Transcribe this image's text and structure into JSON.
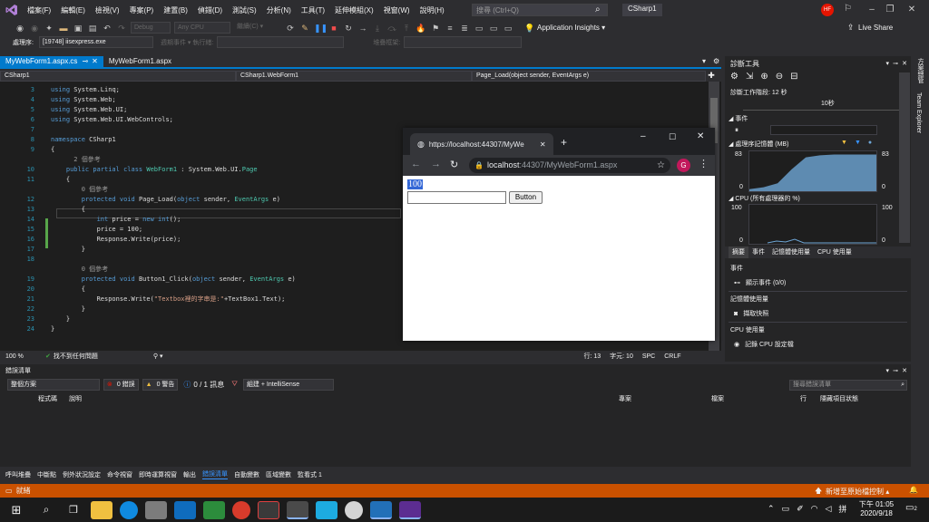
{
  "menu": [
    "檔案(F)",
    "編輯(E)",
    "檢視(V)",
    "專案(P)",
    "建置(B)",
    "偵錯(D)",
    "測試(S)",
    "分析(N)",
    "工具(T)",
    "延伸模組(X)",
    "視窗(W)",
    "說明(H)"
  ],
  "search_placeholder": "搜尋 (Ctrl+Q)",
  "solution_name": "CSharp1",
  "avatar_initials": "HF",
  "toolbar": {
    "config": "Debug",
    "platform": "Any CPU",
    "continue_label": "繼續(C) ▾",
    "app_insights": "Application Insights ▾",
    "live_share": "Live Share"
  },
  "procbar": {
    "process_label": "處理序:",
    "process_value": "[19748] iisexpress.exe",
    "lifecycle": "週期事件 ▾ 執行緒:",
    "stackframe": "堆疊框架:"
  },
  "doc_tabs": [
    "MyWebForm1.aspx.cs",
    "MyWebForm1.aspx"
  ],
  "navbar": {
    "project": "CSharp1",
    "class": "CSharp1.WebForm1",
    "member": "Page_Load(object sender, EventArgs e)"
  },
  "code_lines": [
    {
      "n": "3",
      "code": [
        [
          "kw",
          "using "
        ],
        [
          "tx",
          "System.Linq;"
        ]
      ]
    },
    {
      "n": "4",
      "code": [
        [
          "kw",
          "using "
        ],
        [
          "tx",
          "System.Web;"
        ]
      ]
    },
    {
      "n": "5",
      "code": [
        [
          "kw",
          "using "
        ],
        [
          "tx",
          "System.Web.UI;"
        ]
      ]
    },
    {
      "n": "6",
      "code": [
        [
          "kw",
          "using "
        ],
        [
          "tx",
          "System.Web.UI.WebControls;"
        ]
      ]
    },
    {
      "n": "7",
      "code": []
    },
    {
      "n": "8",
      "code": [
        [
          "kw",
          "namespace "
        ],
        [
          "tx",
          "CSharp1"
        ]
      ]
    },
    {
      "n": "9",
      "code": [
        [
          "tx",
          "{"
        ]
      ]
    },
    {
      "n": "",
      "code": [
        [
          "cm",
          "      2 個參考"
        ]
      ]
    },
    {
      "n": "10",
      "code": [
        [
          "kw",
          "    public partial class "
        ],
        [
          "ty",
          "WebForm1"
        ],
        [
          "tx",
          " : System.Web.UI."
        ],
        [
          "ty",
          "Page"
        ]
      ]
    },
    {
      "n": "11",
      "code": [
        [
          "tx",
          "    {"
        ]
      ]
    },
    {
      "n": "",
      "code": [
        [
          "cm",
          "        0 個參考"
        ]
      ]
    },
    {
      "n": "12",
      "code": [
        [
          "kw",
          "        protected void "
        ],
        [
          "tx",
          "Page_Load("
        ],
        [
          "kw",
          "object "
        ],
        [
          "tx",
          "sender, "
        ],
        [
          "ty",
          "EventArgs"
        ],
        [
          "tx",
          " e)"
        ]
      ]
    },
    {
      "n": "13",
      "code": [
        [
          "tx",
          "        {"
        ]
      ]
    },
    {
      "n": "14",
      "code": [
        [
          "kw",
          "            int"
        ],
        [
          "tx",
          " price = "
        ],
        [
          "kw",
          "new int"
        ],
        [
          "tx",
          "();"
        ]
      ]
    },
    {
      "n": "15",
      "code": [
        [
          "tx",
          "            price = 100;"
        ]
      ]
    },
    {
      "n": "16",
      "code": [
        [
          "tx",
          "            Response.Write(price);"
        ]
      ]
    },
    {
      "n": "17",
      "code": [
        [
          "tx",
          "        }"
        ]
      ]
    },
    {
      "n": "18",
      "code": []
    },
    {
      "n": "",
      "code": [
        [
          "cm",
          "        0 個參考"
        ]
      ]
    },
    {
      "n": "19",
      "code": [
        [
          "kw",
          "        protected void "
        ],
        [
          "tx",
          "Button1_Click("
        ],
        [
          "kw",
          "object "
        ],
        [
          "tx",
          "sender, "
        ],
        [
          "ty",
          "EventArgs"
        ],
        [
          "tx",
          " e)"
        ]
      ]
    },
    {
      "n": "20",
      "code": [
        [
          "tx",
          "        {"
        ]
      ]
    },
    {
      "n": "21",
      "code": [
        [
          "tx",
          "            Response.Write("
        ],
        [
          "st",
          "\"Textbox裡的字串是:\""
        ],
        [
          "tx",
          "+TextBox1.Text);"
        ]
      ]
    },
    {
      "n": "22",
      "code": [
        [
          "tx",
          "        }"
        ]
      ]
    },
    {
      "n": "23",
      "code": [
        [
          "tx",
          "    }"
        ]
      ]
    },
    {
      "n": "24",
      "code": [
        [
          "tx",
          "}"
        ]
      ]
    }
  ],
  "editor_status": {
    "zoom": "100 %",
    "issues": "找不到任何問題",
    "line": "行: 13",
    "col": "字元: 10",
    "spc": "SPC",
    "crlf": "CRLF"
  },
  "browser": {
    "tab_title": "https://localhost:44307/MyWe",
    "url_host": "localhost",
    "url_rest": ":44307/MyWebForm1.aspx",
    "profile": "G",
    "output_text": "100",
    "button_label": "Button"
  },
  "diag": {
    "title": "診斷工具",
    "session": "診斷工作階段: 12 秒",
    "timeline_tick": "10秒",
    "events": "事件",
    "memory": "處理序記憶體 (MB)",
    "mem_max": "83",
    "mem_min": "0",
    "cpu": "CPU (所有處理器的 %)",
    "cpu_max": "100",
    "cpu_min": "0",
    "tabs": [
      "摘要",
      "事件",
      "記憶體使用量",
      "CPU 使用量"
    ],
    "sec_events": "事件",
    "show_events": "顯示事件 (0/0)",
    "sec_memory": "記憶體使用量",
    "snapshot": "擷取快照",
    "sec_cpu": "CPU 使用量",
    "record_cpu": "記錄 CPU 設定檔"
  },
  "memory_fill": [
    0.05,
    0.1,
    0.2,
    0.55,
    0.85,
    0.9,
    0.92,
    0.92,
    0.92,
    0.92
  ],
  "right_tabs": [
    "方案總管",
    "Team Explorer"
  ],
  "errlist": {
    "title": "錯誤清單",
    "scope": "整個方案",
    "errors": "0 錯誤",
    "warnings": "0 警告",
    "messages": "0 / 1 訊息",
    "build_filter": "組建 + IntelliSense",
    "search": "搜尋錯誤清單",
    "col_code": "程式碼",
    "col_desc": "說明",
    "col_project": "專案",
    "col_file": "檔案",
    "col_line": "行",
    "col_suppress": "隱藏項目狀態"
  },
  "bottom_tabs": [
    "呼叫堆疊",
    "中斷點",
    "例外狀況設定",
    "命令視窗",
    "即時運算視窗",
    "輸出",
    "錯誤清單",
    "自動變數",
    "區域變數",
    "監看式 1"
  ],
  "statusbar": {
    "ready": "就緒",
    "source_control": "新增至原始檔控制 ▴"
  },
  "taskbar": {
    "time": "下午 01:05",
    "date": "2020/9/18",
    "notif": "2"
  }
}
